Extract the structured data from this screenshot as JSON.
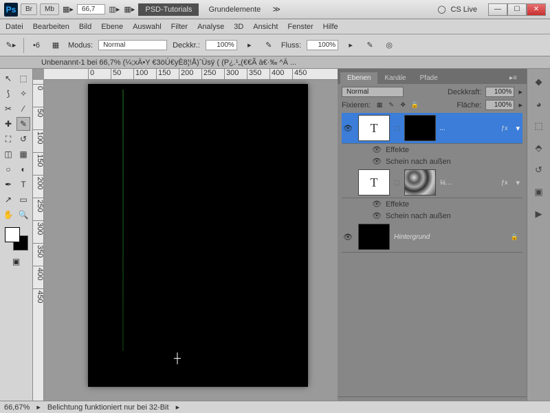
{
  "titlebar": {
    "br": "Br",
    "mb": "Mb",
    "zoom": "66,7",
    "tab_psd": "PSD-Tutorials",
    "tab_grund": "Grundelemente",
    "cslive": "CS Live"
  },
  "menu": [
    "Datei",
    "Bearbeiten",
    "Bild",
    "Ebene",
    "Auswahl",
    "Filter",
    "Analyse",
    "3D",
    "Ansicht",
    "Fenster",
    "Hilfe"
  ],
  "options": {
    "brush_size": "6",
    "modus_label": "Modus:",
    "modus_value": "Normal",
    "deckkr_label": "Deckkr.:",
    "deckkr_value": "100%",
    "fluss_label": "Fluss:",
    "fluss_value": "100%"
  },
  "doc_title": "Unbenannt-1 bei 66,7% (¼;xÄ•Y €3öÚ€yÈ8¦!Å)ˆÙsÿ     (  (P¿.¹„(€€Ã à€·‰ ^Ä ...",
  "ruler_h": [
    "0",
    "50",
    "100",
    "150",
    "200",
    "250",
    "300",
    "350",
    "400",
    "450"
  ],
  "ruler_v": [
    "0",
    "50",
    "100",
    "150",
    "200",
    "250",
    "300",
    "350",
    "400",
    "450"
  ],
  "layers_panel": {
    "tabs": [
      "Ebenen",
      "Kanäle",
      "Pfade"
    ],
    "blend": "Normal",
    "deckkraft_label": "Deckkraft:",
    "deckkraft": "100%",
    "fixieren": "Fixieren:",
    "flaeche_label": "Fläche:",
    "flaeche": "100%",
    "effekte": "Effekte",
    "schein": "Schein nach außen",
    "layer_t": "T",
    "dots": "...",
    "quarter": "¼…",
    "fx": "ƒx",
    "hintergrund": "Hintergrund",
    "lock": "🔒"
  },
  "status": {
    "zoom": "66,67%",
    "msg": "Belichtung funktioniert nur bei 32-Bit"
  },
  "icons": {
    "move": "↖",
    "marquee": "⬚",
    "lasso": "⟆",
    "wand": "✧",
    "crop": "✂",
    "eyedrop": "⁄",
    "heal": "✚",
    "brush": "✎",
    "stamp": "⛶",
    "history": "↺",
    "eraser": "◫",
    "gradient": "▦",
    "blur": "○",
    "dodge": "◐",
    "pen": "✒",
    "type": "T",
    "path": "↗",
    "shape": "▭",
    "hand": "✋",
    "zoom2": "🔍",
    "mode": "▣"
  }
}
